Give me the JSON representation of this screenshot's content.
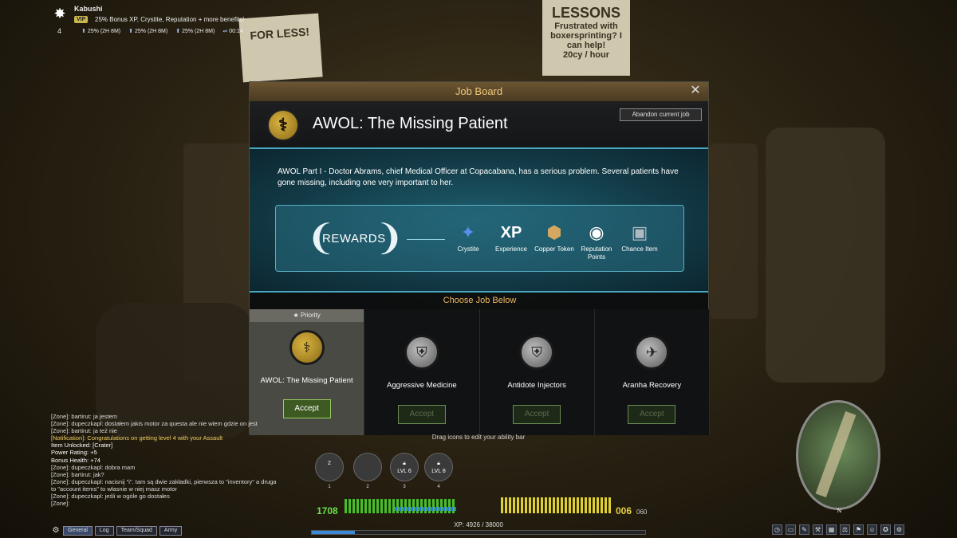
{
  "player": {
    "name": "Kabushi",
    "level": "4",
    "vip_badge": "VIP",
    "vip_text": "25% Bonus XP, Crystite, Reputation + more benefits!",
    "boosts": [
      "25% (2H 8M)",
      "25% (2H 8M)",
      "25% (2H 8M)"
    ],
    "timer": "00:14"
  },
  "background": {
    "poster_left": "FOR LESS!",
    "poster_right_title": "LESSONS",
    "poster_right_text": "Frustrated with boxersprinting? I can help!",
    "poster_right_price": "20cy / hour"
  },
  "job_board": {
    "header": "Job Board",
    "close": "✕",
    "current_job_title": "AWOL: The Missing Patient",
    "abandon_button": "Abandon current job",
    "description": "AWOL Part I - Doctor Abrams, chief Medical Officer at Copacabana, has a serious problem.  Several patients have gone missing, including one very important to her.",
    "rewards_label": "REWARDS",
    "rewards": [
      {
        "label": "Crystite",
        "icon": "crystite-icon"
      },
      {
        "label": "Experience",
        "icon": "xp-icon",
        "glyph": "XP"
      },
      {
        "label": "Copper Token",
        "icon": "copper-token-icon"
      },
      {
        "label": "Reputation Points",
        "icon": "reputation-icon"
      },
      {
        "label": "Chance Item",
        "icon": "chance-item-icon"
      }
    ],
    "choose_label": "Choose Job Below",
    "priority_tag": "★ Priority",
    "jobs": [
      {
        "title": "AWOL: The Missing Patient",
        "accept": "Accept",
        "enabled": true
      },
      {
        "title": "Aggressive Medicine",
        "accept": "Accept",
        "enabled": false
      },
      {
        "title": "Antidote Injectors",
        "accept": "Accept",
        "enabled": false
      },
      {
        "title": "Aranha Recovery",
        "accept": "Accept",
        "enabled": false
      }
    ]
  },
  "chat": {
    "lines": [
      "[Zone]: bartirut: ja jestem",
      "[Zone]: dupeczkapl: dostałem jakis motor za questa ale nie wiem gdzie on jest",
      "[Zone]: bartirut: ja też nie",
      "[Notification]: Congratulations on getting level 4 with your Assault",
      "Item Unlocked: [Crater]",
      "Power Rating: +5",
      "Bonus Health: +74",
      "[Zone]: dupeczkapl: dobra mam",
      "[Zone]: bartirut: jak?",
      "[Zone]: dupeczkapl: nacisnij \"i\". tam są dwie zakładki, pierwsza to \"inventory\" a druga",
      "to \"account items\" to własnie w niej masz motor",
      "[Zone]: dupeczkapl: jeśli w ogóle go dostałes",
      "[Zone]:"
    ],
    "tabs": [
      "General",
      "Log",
      "Team/Squad",
      "Army"
    ]
  },
  "hud": {
    "ability_hint": "Drag icons to edit your ability bar",
    "abilities": [
      {
        "num": "1",
        "label": "2"
      },
      {
        "num": "2",
        "label": ""
      },
      {
        "num": "3",
        "label": "LVL 6"
      },
      {
        "num": "4",
        "label": "LVL 8"
      }
    ],
    "power": "1708",
    "ammo": "006",
    "ammo_reserve": "060",
    "xp_text": "XP: 4926 / 38000",
    "xp_fraction": 0.13,
    "minimap_north": "N"
  },
  "colors": {
    "accent_gold": "#f0c878",
    "rewards_cyan": "#48a8c0",
    "accept_green": "#3d5a22"
  }
}
